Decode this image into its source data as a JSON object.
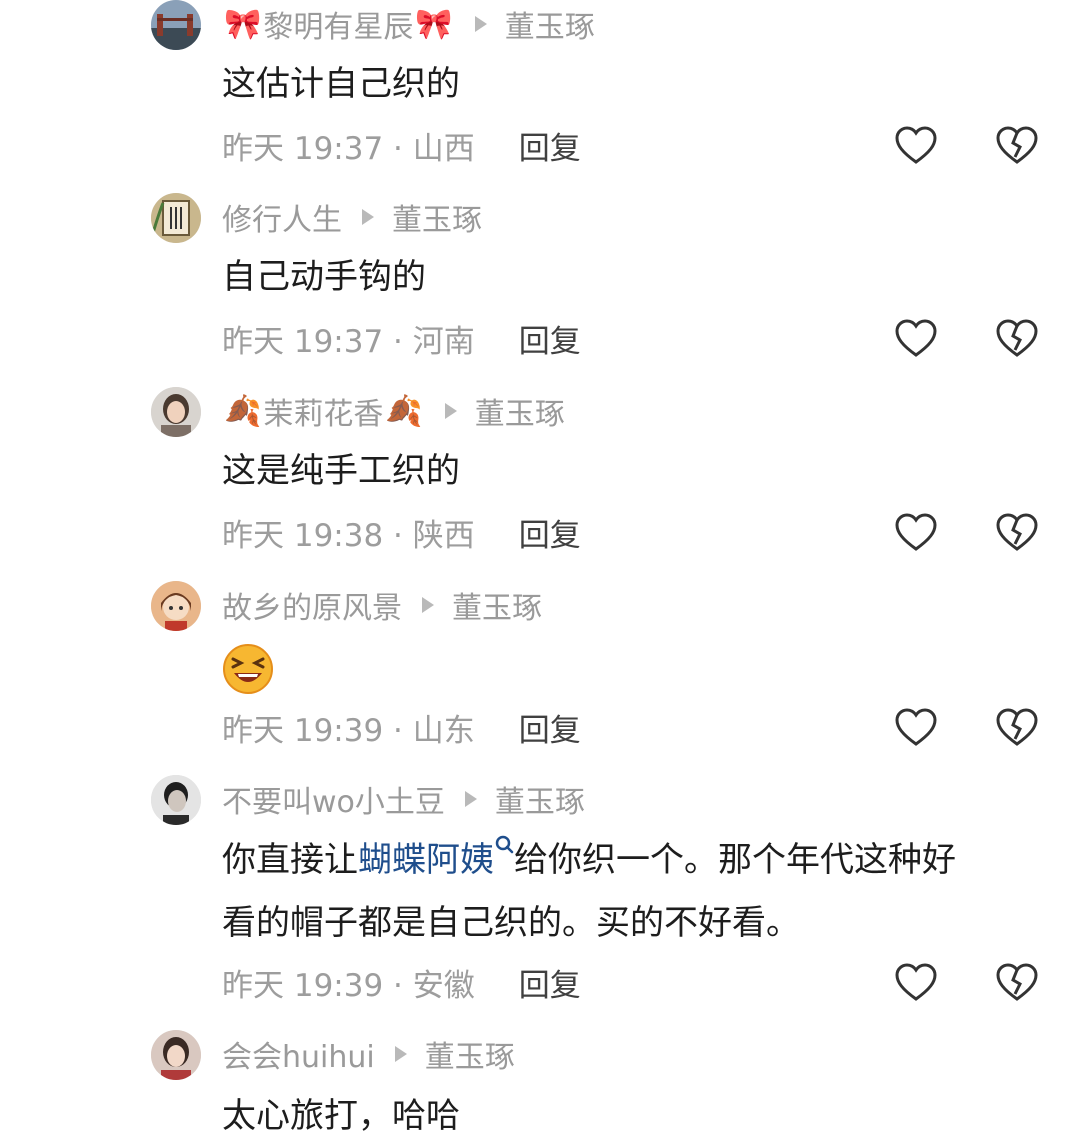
{
  "comments": [
    {
      "user": "黎明有星辰",
      "deco": "🎀",
      "reply_to": "董玉琢",
      "text": "这估计自己织的",
      "time_location": "昨天 19:37 · 山西",
      "reply_label": "回复"
    },
    {
      "user": "修行人生",
      "reply_to": "董玉琢",
      "text": "自己动手钩的",
      "time_location": "昨天 19:37 · 河南",
      "reply_label": "回复"
    },
    {
      "user": "茉莉花香",
      "deco": "🍂",
      "reply_to": "董玉琢",
      "text": "这是纯手工织的",
      "time_location": "昨天 19:38 · 陕西",
      "reply_label": "回复"
    },
    {
      "user": "故乡的原风景",
      "reply_to": "董玉琢",
      "text_emoji": "laughing-face",
      "time_location": "昨天 19:39 · 山东",
      "reply_label": "回复"
    },
    {
      "user": "不要叫wo小土豆",
      "reply_to": "董玉琢",
      "text_part1": "你直接让",
      "text_link": "蝴蝶阿姨",
      "text_part2": "给你织一个。那个年代这种好",
      "text_line2": "看的帽子都是自己织的。买的不好看。",
      "time_location": "昨天 19:39 · 安徽",
      "reply_label": "回复"
    },
    {
      "user": "会会huihui",
      "reply_to": "董玉琢",
      "text": "太心旅打，哈哈"
    }
  ],
  "colors": {
    "link": "#1f4e8c",
    "meta": "#9d9d9d",
    "text": "#1d1d1d"
  },
  "icons": [
    "heart-outline-icon",
    "broken-heart-icon",
    "search-icon"
  ]
}
